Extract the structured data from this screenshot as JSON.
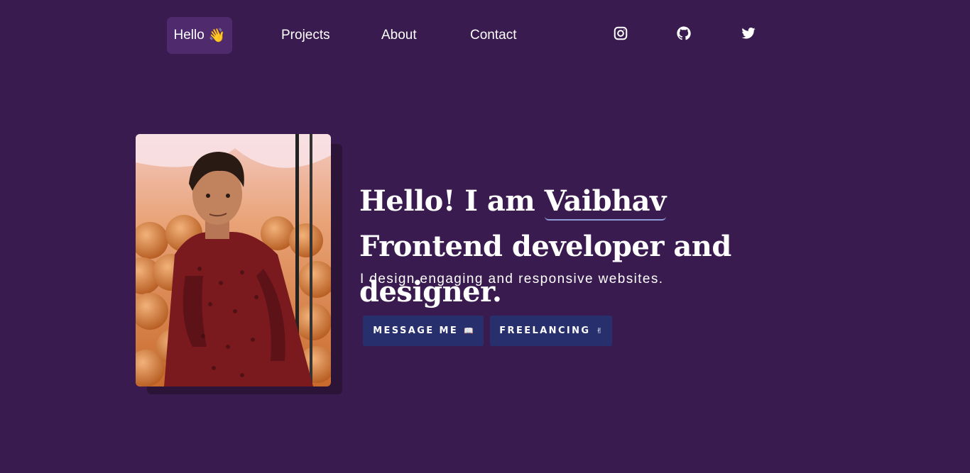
{
  "nav": {
    "hello_label": "Hello",
    "hello_emoji": "👋",
    "projects_label": "Projects",
    "about_label": "About",
    "contact_label": "Contact"
  },
  "social": [
    {
      "name": "instagram-icon"
    },
    {
      "name": "github-icon"
    },
    {
      "name": "twitter-icon"
    }
  ],
  "hero": {
    "headline_prefix": "Hello! I am",
    "name": "Vaibhav",
    "headline_suffix": "Frontend developer and designer.",
    "subtitle": "I design engaging and responsive websites.",
    "message_button": "MESSAGE ME",
    "message_emoji": "📖",
    "freelance_button": "FREELANCING",
    "freelance_emoji": "✌"
  },
  "colors": {
    "background": "#391b4f",
    "nav_active": "#4f2a6d",
    "button": "#27306d",
    "underline": "#8f9ad8"
  }
}
